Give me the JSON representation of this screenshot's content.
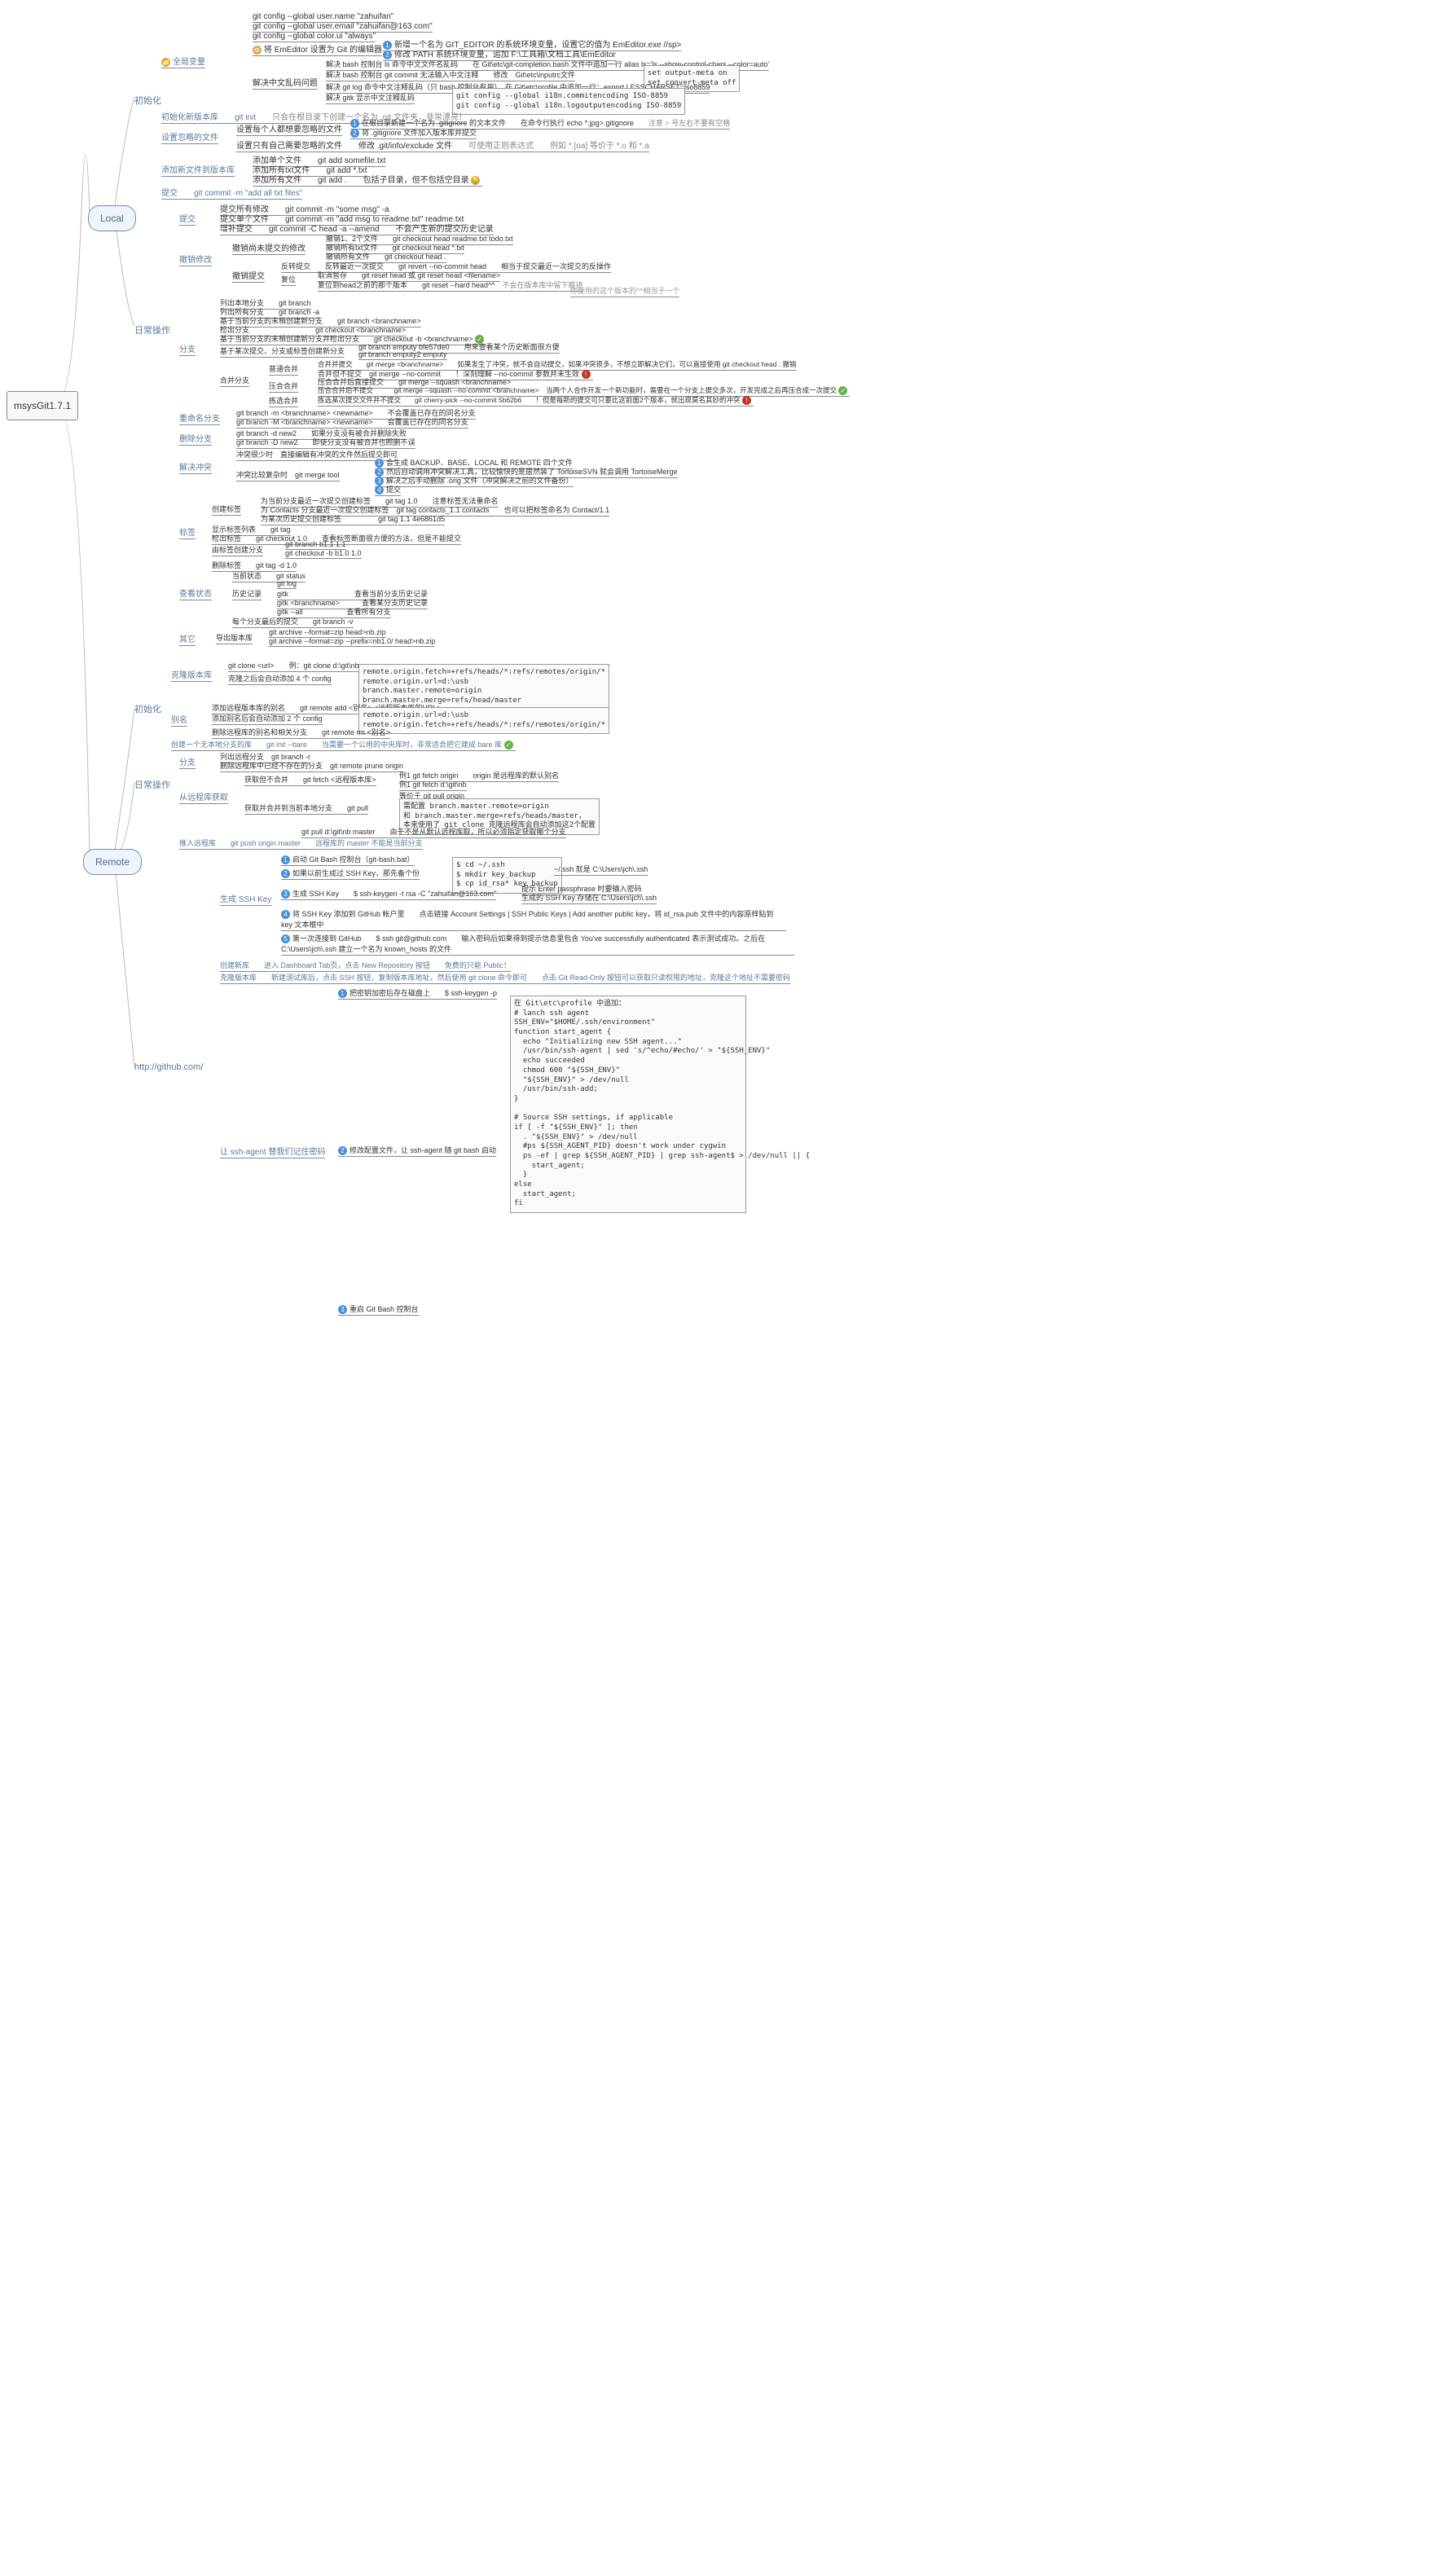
{
  "root": "msysGit1.7.1",
  "local": "Local",
  "remote": "Remote",
  "init": "初始化",
  "daily": "日常操作",
  "github": "http://github.com/",
  "glob": "全局变量",
  "g1": "git config --global user.name \"zahuifan\"",
  "g2": "git config --global user.email \"zahuifan@163.com\"",
  "g3": "git config --global color.ui \"always\"",
  "g4": "将 EmEditor 设置为 Git 的编辑器",
  "g4a": "新增一个名为 GIT_EDITOR 的系统环境变量，设置它的值为 EmEditor.exe //sp>",
  "g4b": "修改 PATH 系统环境变量，追加 F:\\工具箱\\文档工具\\EmEditor",
  "g5": "解决中文乱码问题",
  "g5a": "解决 bash 控制台 ls 命令中文文件名乱码　　在 Git\\etc\\git-completion.bash 文件中追加一行 alias ls='ls --show-control-chars --color=auto'",
  "g5b": "解决 bash 控制台 git commit 无法输入中文注释　　修改　Git\\etc\\inputrc文件",
  "g5b2": "set output-meta on\nset convert-meta off",
  "g5c": "解决 git log 命令中文注释乱码（只 bash 控制台有用）　在 Git\\etc\\profile 中追加一行：export LESSCHARSET=iso8859",
  "g5d": "解决 gitk 显示中文注释乱码",
  "g5d1": "git config --global i18n.commitencoding ISO-8859\ngit config --global i18n.logoutputencoding ISO-8859",
  "initrepo": "初始化新版本库",
  "initrepo1": "git init",
  "initrepo2": "只会在根目录下创建一个名为 .git 文件夹，非常漂亮！",
  "ignore": "设置忽略的文件",
  "ig1": "设置每个人都想要忽略的文件",
  "ig1a": "在根目录新建一个名为 .gitignore 的文本文件",
  "ig1b": "在命令行执行 echo *.jpg>.gitignore",
  "ig1c": "注意 > 号左右不要有空格",
  "ig1d": "将 .gitignore 文件加入版本库并提交",
  "ig2": "设置只有自己需要忽略的文件",
  "ig2a": "修改 .git/info/exclude 文件",
  "ig2b": "可使用正则表达式",
  "ig2c": "例如 *.[oa] 等价于 *.o 和 *.a",
  "add": "添加新文件到版本库",
  "add1": "添加单个文件　　git add somefile.txt",
  "add2": "添加所有txt文件　　git add *.txt",
  "add3": "添加所有文件　　git add .　　包括子目录，但不包括空目录",
  "commit": "提交",
  "commit1": "git commit -m \"add all txt files\"",
  "ci": "提交",
  "ci1": "提交所有修改　　git commit -m \"some msg\" -a",
  "ci2": "提交单个文件　　git commit -m \"add msg to readme.txt\" readme.txt",
  "ci3": "增补提交　　git commit -C head -a --amend　　不会产生新的提交历史记录",
  "undo": "撤销修改",
  "un1": "撤销尚未提交的修改",
  "un1a": "撤销1、2个文件　　git checkout head readme.txt todo.txt",
  "un1b": "撤销所有txt文件　　git checkout head *.txt",
  "un1c": "撤销所有文件　　git checkout head .",
  "un2": "撤销提交",
  "un2a": "反转提交　　反转最近一次提交　　git revert --no-commit head　　相当于提交最近一次提交的反操作",
  "un2b": "复位",
  "un2b1": "取消暂存　　git reset head 或 git reset head <filename>",
  "un2b2": "复位到head之前的那个版本　　git reset --hard head^^",
  "un2b3": "不会在版本库中留下痕迹",
  "un2b4": "你使用的这个版本的^^相当于一个",
  "branch": "分支",
  "b1": "列出本地分支　　git branch",
  "b2": "列出所有分支　　git branch -a",
  "b3": "基于当前分支的末梢创建新分支　　git branch <branchname>",
  "b4": "检出分支　　　　　　　　　git checkout <branchname>",
  "b5": "基于当前分支的末梢创建新分支并检出分支　　git checkout -b <branchname>",
  "b6": "基于某次提交、分支或标签创建新分支",
  "b6a": "git branch emputy bfe57de0　　用来查看某个历史断面很方便",
  "b6b": "git branch emputy2 emputy",
  "b7": "合并分支",
  "b7a": "普通合并",
  "b7a1": "合并并提交　　git merge <branchname>　　如果发生了冲突，就不会自动提交，如果冲突很多，不想立即解决它们，可以直接使用 git checkout head . 撤销",
  "b7a2": "合并但不提交　git merge --no-commit　　！深刻理解 --no-commit 参数并未生效",
  "b7b": "压合合并",
  "b7b1": "压合合并后直接提交　　git merge --squash <branchname>",
  "b7b2": "压合合并后不提交　　　git merge --squash --no-commit <branchname>　当两个人合作开发一个新功能时，需要在一个分支上提交多次，开发完成之后再压合成一次提交",
  "b7c": "拣选合并",
  "b7c1": "拣选某次提交文件并不提交　　git cherry-pick --no-commit 5b62b6　　！但是每新的提交可只要比这前面2个版本，就出现莫名其妙的冲突",
  "rename": "重命名分支",
  "rn1": "git branch -m <branchname> <newname>　　不会覆盖已存在的同名分支",
  "rn2": "git branch -M <branchname> <newname>　　会覆盖已存在的同名分支",
  "delb": "删除分支",
  "delb1": "git branch -d new2　　如果分支没有被合并删除失败",
  "delb2": "git branch -D new2　　即使分支没有被合并也照删不误",
  "conflict": "解决冲突",
  "cf1": "冲突很少时　直接编辑有冲突的文件然后提交即可",
  "cf2": "冲突比较复杂时　git merge tool",
  "cf2a": "会生成 BACKUP、BASE、LOCAL 和 REMOTE 四个文件",
  "cf2b": "然后自动调用冲突解决工具，比较愉快的是居然装了 TortoiseSVN 就会调用 TortoiseMerge",
  "cf2c": "解决之后手动删除 .orig 文件（冲突解决之前的文件备份）",
  "cf2d": "提交",
  "tag": "标签",
  "tg1": "创建标签",
  "tg1a": "为当前分支最近一次提交创建标签　　git tag 1.0　　注意标签无法重命名",
  "tg1b": "为 Contacts 分支最近一次提交创建标签　git tag contacts_1.1 contacts　　也可以把标签命名为 Contact/1.1",
  "tg1c": "为某次历史提交创建标签　　　　　git tag 1.1 4e6861d5",
  "tg2": "显示标签列表　　git tag",
  "tg3": "检出标签　　git checkout 1.0　　查看标签断面很方便的方法，但是不能提交",
  "tg4": "由标签创建分支",
  "tg4a": "git branch b1.1 1.1",
  "tg4b": "git checkout -b b1.0 1.0",
  "tg5": "删除标签　　git tag -d 1.0",
  "status": "查看状态",
  "st1": "当前状态　　git status",
  "st2": "历史记录",
  "st2a": "git log",
  "st2b": "gitk　　　　　　　　　查看当前分支历史记录",
  "st2c": "gitk <branchname>　　　查看某分支历史记录",
  "st2d": "gitk --all　　　　　　查看所有分支",
  "st3": "每个分支最后的提交　　git branch -v",
  "other": "其它",
  "ot1": "导出版本库",
  "ot1a": "git archive --format=zip head>nb.zip",
  "ot1b": "git archive --format=zip --prefix=nb1.0/ head>nb.zip",
  "rinit": "初始化",
  "clone": "克隆版本库",
  "cl1": "git clone <url>　　例：git clone d:\\git\\nb",
  "cl2": "克隆之后会自动添加 4 个 config",
  "cl2a": "remote.origin.fetch=+refs/heads/*:refs/remotes/origin/*\nremote.origin.url=d:\\usb\nbranch.master.remote=origin\nbranch.master.merge=refs/head/master",
  "alias": "别名",
  "al1": "添加远程版本库的别名　　git remote add <别名> <远程版本库的URL>",
  "al2": "添加别名后会自动添加 2 个 config",
  "al2a": "remote.origin.url=d:\\usb\nremote.origin.fetch=+refs/heads/*:refs/remotes/origin/*",
  "al3": "删除远程库的别名和相关分支　　git remote rm <别名>",
  "bare": "创建一个无本地分支的库　　git init --bare　　当需要一个公用的中央库时，非常适合把它建成 bare 库",
  "rbranch": "分支",
  "rb1": "列出远程分支　git branch -r",
  "rb2": "删除远程库中已经不存在的分支　git remote prune origin",
  "fetch": "从远程库获取",
  "f1": "获取但不合并　　git fetch <远程版本库>",
  "f1a": "例1 git fetch origin　　origin 是远程库的默认别名",
  "f1b": "例1 git fetch d:\\git\\nb",
  "f2": "获取并合并到当前本地分支　　git pull",
  "f2a": "等价于 git pull origin",
  "f2b": "需配置 branch.master.remote=origin\n和 branch.master.merge=refs/heads/master，\n本来使用了 git clone 克隆远程库会自动添加这2个配置",
  "f2c": "git pull d:\\git\\nb master　　由于不是从默认远程库取，所以必须指定获取哪个分支",
  "push": "推入远程库　　git push origin master　　远程库的 master 不能是当前分支",
  "sshkey": "生成 SSH Key",
  "sk1": "启动 Git Bash 控制台（git-bash.bat）",
  "sk2": "如果以前生成过 SSH Key，那先备个份",
  "sk2a": "$ cd ~/.ssh\n$ mkdir key_backup\n$ cp id_rsa* key_backup",
  "sk2b": "~/.ssh 就是 C:\\Users\\jch\\.ssh",
  "sk3": "生成 SSH Key　　$ ssh-keygen -t rsa -C \"zahuifan@163.com\"",
  "sk3a": "提示 Enter passphrase 时要输入密码",
  "sk3b": "生成的 SSH Key 存储在 C:\\Users\\jch\\.ssh",
  "sk4": "将 SSH Key 添加到 GitHub 帐户里　　点击链接 Account Settings | SSH Public Keys | Add another public key，将 id_rsa.pub\n文件中的内容原样贴到 key 文本框中",
  "sk5": "第一次连接到 GitHub　　$ ssh git@github.com",
  "sk5a": "输入密码后如果得到提示信息里包含 You've successfully authenticated 表示测试成功。之后在\nC:\\Users\\jch\\.ssh 建立一个名为 known_hosts 的文件",
  "newrepo": "创建新库　　进入 Dashboard Tab页，点击 New Repository 按钮　　免费的只能 Public！",
  "clonegh": "克隆版本库　　新建测试库后，点击 SSH 按钮，复制版本库地址，然后使用 git clone 命令即可　　点击 Git Read-Only 按钮可以获取只读权限的地址，克隆这个地址不需要密码",
  "sshagent": "让 ssh-agent 替我们记住密码",
  "sa1": "把密钥加密后存在磁盘上　　$ ssh-keygen -p",
  "sa2": "修改配置文件，让 ssh-agent 随 git bash 启动",
  "sa2code": "在 Git\\etc\\profile 中追加：\n# lanch ssh agent\nSSH_ENV=\"$HOME/.ssh/environment\"\nfunction start_agent {\n  echo \"Initializing new SSH agent...\"\n  /usr/bin/ssh-agent | sed 's/^echo/#echo/' > \"${SSH_ENV}\"\n  echo succeeded\n  chmod 600 \"${SSH_ENV}\"\n  \"${SSH_ENV}\" > /dev/null\n  /usr/bin/ssh-add;\n}\n\n# Source SSH settings, if applicable\nif [ -f \"${SSH_ENV}\" ]; then\n  . \"${SSH_ENV}\" > /dev/null\n  #ps ${SSH_AGENT_PID} doesn't work under cygwin\n  ps -ef | grep ${SSH_AGENT_PID} | grep ssh-agent$ > /dev/null || {\n    start_agent;\n  }\nelse\n  start_agent;\nfi",
  "sa3": "重启 Git Bash 控制台",
  "chart_data": null
}
